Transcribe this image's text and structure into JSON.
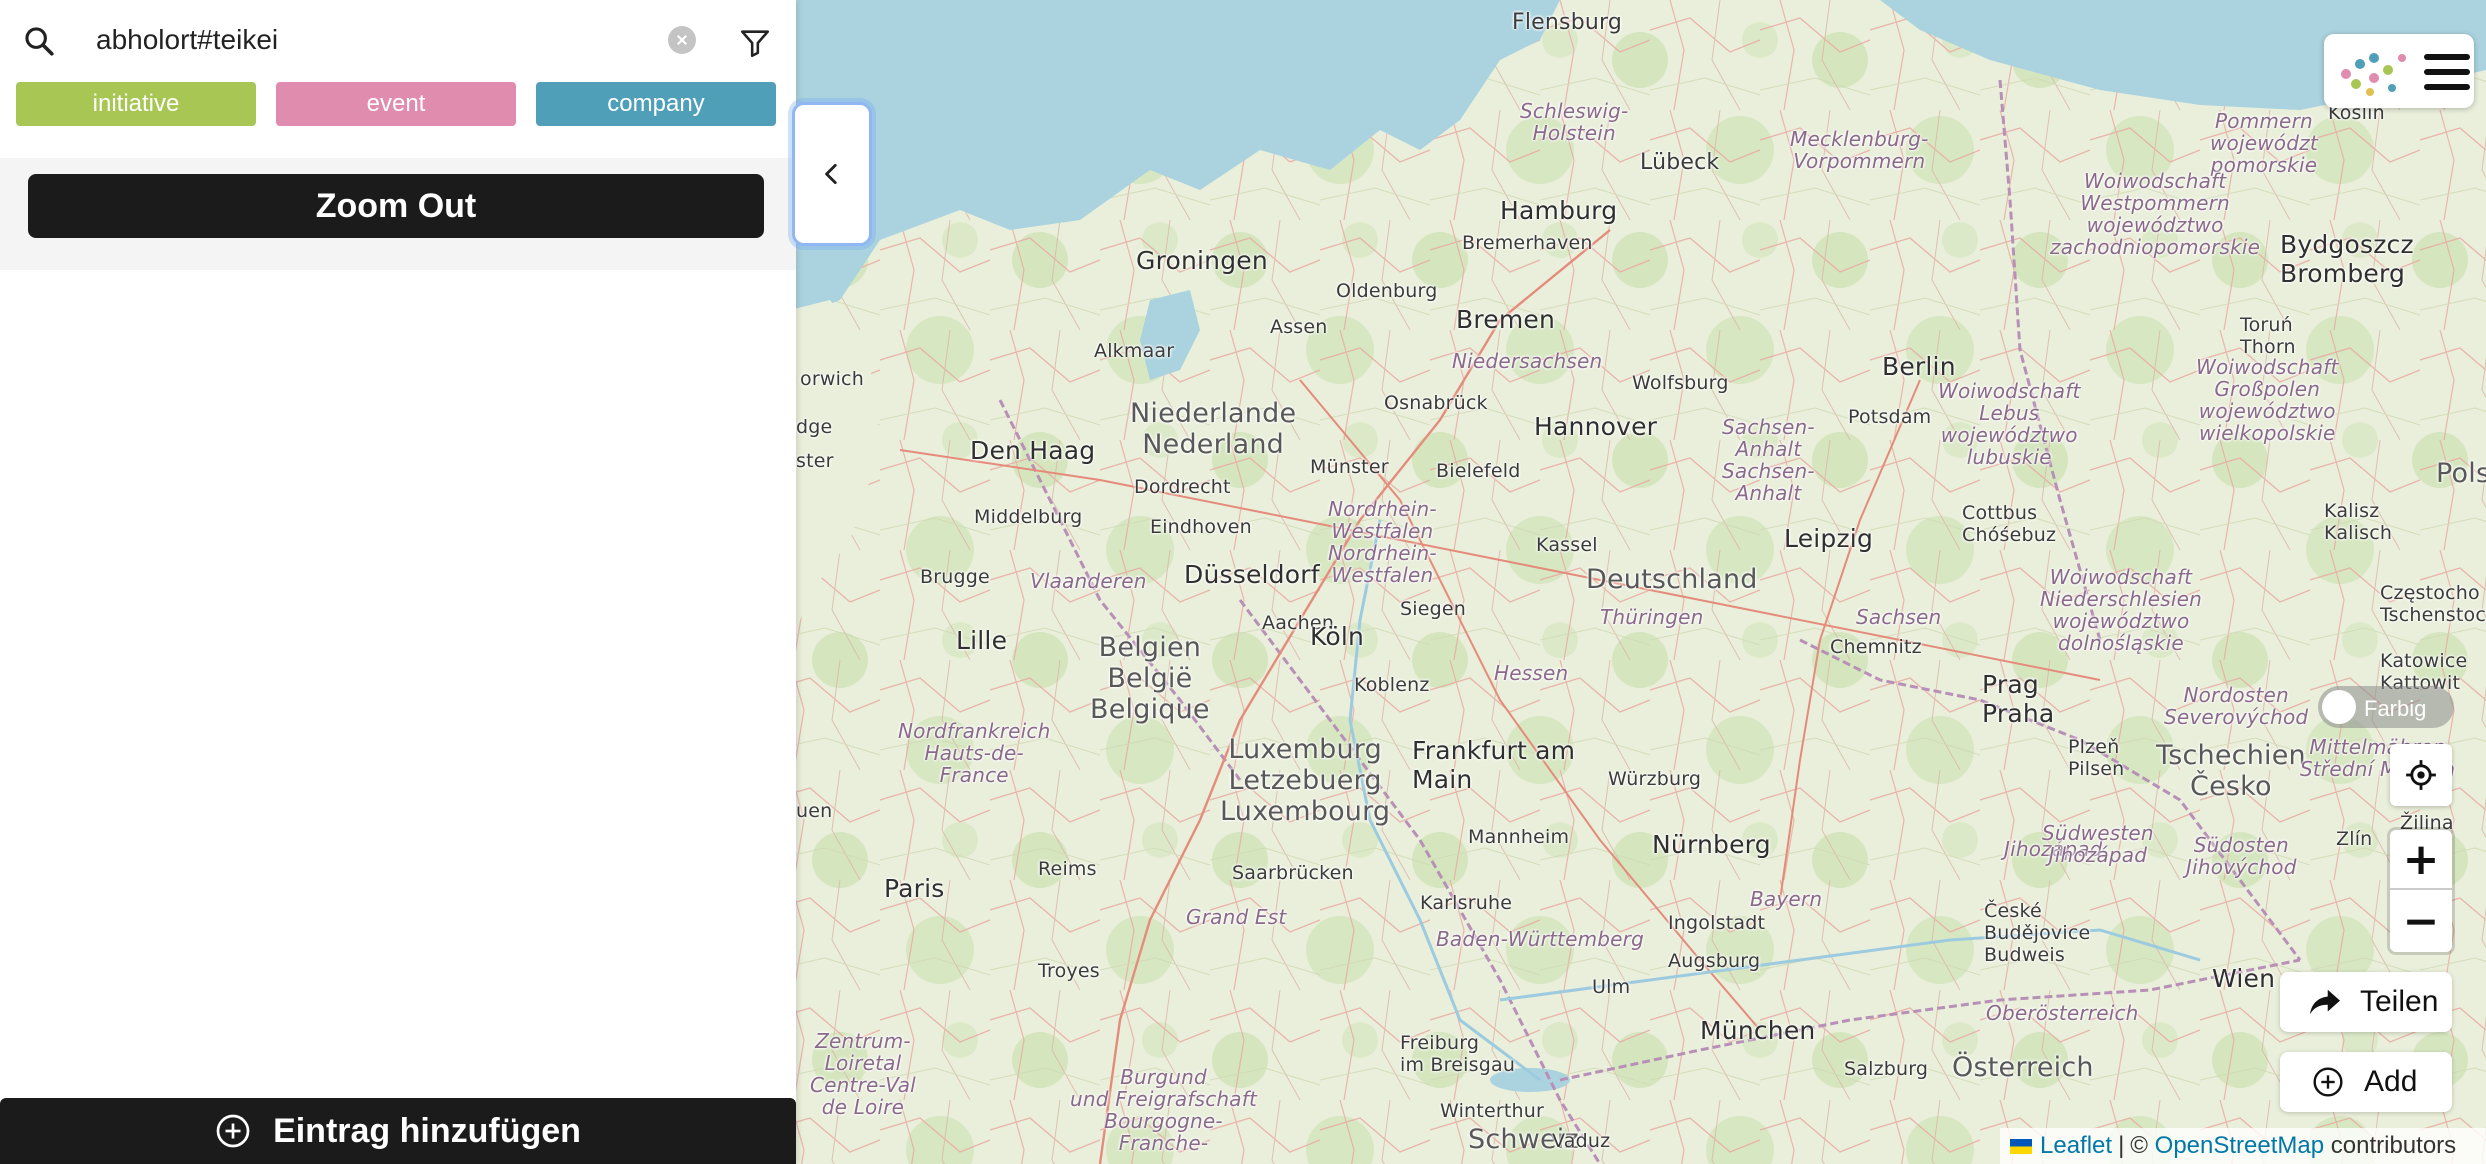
{
  "search": {
    "value": "abholort#teikei"
  },
  "tags": [
    {
      "label": "initiative",
      "color": "#a8c653"
    },
    {
      "label": "event",
      "color": "#e08caf"
    },
    {
      "label": "company",
      "color": "#4f9fb9"
    }
  ],
  "zoom_out_label": "Zoom Out",
  "add_entry_label": "Eintrag hinzufügen",
  "controls": {
    "toggle_label": "Farbig",
    "share_label": "Teilen",
    "add_label": "Add"
  },
  "attribution": {
    "leaflet": "Leaflet",
    "separator": "|",
    "copyright": "©",
    "osm": "OpenStreetMap",
    "contributors": "contributors"
  },
  "map": {
    "labels": [
      {
        "text": "Flensburg",
        "cls": ""
      },
      {
        "text": "Schleswig-\nHolstein",
        "cls": "region"
      },
      {
        "text": "Lübeck",
        "cls": ""
      },
      {
        "text": "Mecklenburg-\nVorpommern",
        "cls": "region"
      },
      {
        "text": "Koszalin\nKöslin",
        "cls": "small"
      },
      {
        "text": "Hamburg",
        "cls": "big"
      },
      {
        "text": "Bremerhaven",
        "cls": "small"
      },
      {
        "text": "Groningen",
        "cls": "big"
      },
      {
        "text": "Oldenburg",
        "cls": "small"
      },
      {
        "text": "Bremen",
        "cls": "big"
      },
      {
        "text": "Alkmaar",
        "cls": "small"
      },
      {
        "text": "Assen",
        "cls": "small"
      },
      {
        "text": "Niedersachsen",
        "cls": "region"
      },
      {
        "text": "Wolfsburg",
        "cls": "small"
      },
      {
        "text": "Berlin",
        "cls": "big"
      },
      {
        "text": "Potsdam",
        "cls": "small"
      },
      {
        "text": "Osnabrück",
        "cls": "small"
      },
      {
        "text": "Hannover",
        "cls": "big"
      },
      {
        "text": "Niederlande\nNederland",
        "cls": "country"
      },
      {
        "text": "Den Haag",
        "cls": "big"
      },
      {
        "text": "Münster",
        "cls": "small"
      },
      {
        "text": "Bielefeld",
        "cls": "small"
      },
      {
        "text": "Sachsen-\nAnhalt\nSachsen-\nAnhalt",
        "cls": "region"
      },
      {
        "text": "Dordrecht",
        "cls": "small"
      },
      {
        "text": "Middelburg",
        "cls": "small"
      },
      {
        "text": "Eindhoven",
        "cls": "small"
      },
      {
        "text": "Nordrhein-\nWestfalen\nNordrhein-\nWestfalen",
        "cls": "region"
      },
      {
        "text": "Kassel",
        "cls": "small"
      },
      {
        "text": "Cottbus\nChóśebuz",
        "cls": "small"
      },
      {
        "text": "Leipzig",
        "cls": "big"
      },
      {
        "text": "Düsseldorf",
        "cls": "big"
      },
      {
        "text": "Brugge",
        "cls": "small"
      },
      {
        "text": "Vlaanderen",
        "cls": "region"
      },
      {
        "text": "Deutschland",
        "cls": "country"
      },
      {
        "text": "Aachen",
        "cls": "small"
      },
      {
        "text": "Siegen",
        "cls": "small"
      },
      {
        "text": "Thüringen",
        "cls": "region"
      },
      {
        "text": "Sachsen",
        "cls": "region"
      },
      {
        "text": "Köln",
        "cls": "big"
      },
      {
        "text": "Lille",
        "cls": "big"
      },
      {
        "text": "Belgien\nBelgië\nBelgique",
        "cls": "country"
      },
      {
        "text": "Chemnitz",
        "cls": "small"
      },
      {
        "text": "Koblenz",
        "cls": "small"
      },
      {
        "text": "Hessen",
        "cls": "region"
      },
      {
        "text": "Prag\nPraha",
        "cls": "big"
      },
      {
        "text": "Nordfrankreich\nHauts-de-\nFrance",
        "cls": "region"
      },
      {
        "text": "Frankfurt am\nMain",
        "cls": "big"
      },
      {
        "text": "Luxemburg\nLetzebuerg\nLuxembourg",
        "cls": "country"
      },
      {
        "text": "Plzeň\nPilsen",
        "cls": "small"
      },
      {
        "text": "Tschechien\nČesko",
        "cls": "country"
      },
      {
        "text": "Würzburg",
        "cls": "small"
      },
      {
        "text": "Mannheim",
        "cls": "small"
      },
      {
        "text": "Nürnberg",
        "cls": "big"
      },
      {
        "text": "Paris",
        "cls": "big"
      },
      {
        "text": "Reims",
        "cls": "small"
      },
      {
        "text": "Saarbrücken",
        "cls": "small"
      },
      {
        "text": "Jihozápad",
        "cls": "region"
      },
      {
        "text": "Grand Est",
        "cls": "region"
      },
      {
        "text": "Karlsruhe",
        "cls": "small"
      },
      {
        "text": "Ingolstadt",
        "cls": "small"
      },
      {
        "text": "Bayern",
        "cls": "region"
      },
      {
        "text": "České\nBudějovice\nBudweis",
        "cls": "small"
      },
      {
        "text": "Baden-Württemberg",
        "cls": "region"
      },
      {
        "text": "Troyes",
        "cls": "small"
      },
      {
        "text": "Augsburg",
        "cls": "small"
      },
      {
        "text": "Ulm",
        "cls": "small"
      },
      {
        "text": "Wien",
        "cls": "big"
      },
      {
        "text": "Oberösterreich",
        "cls": "region"
      },
      {
        "text": "München",
        "cls": "big"
      },
      {
        "text": "Zentrum-\nLoiretal\nCentre-Val\nde Loire",
        "cls": "region"
      },
      {
        "text": "Freiburg\nim Breisgau",
        "cls": "small"
      },
      {
        "text": "Salzburg",
        "cls": "small"
      },
      {
        "text": "Österreich",
        "cls": "country"
      },
      {
        "text": "Burgund\nund Freigrafschaft\nBourgogne-\nFranche-",
        "cls": "region"
      },
      {
        "text": "Winterthur",
        "cls": "small"
      },
      {
        "text": "Schweiz",
        "cls": "country"
      },
      {
        "text": "Vaduz",
        "cls": "small"
      },
      {
        "text": "Bydgoszcz\nBromberg",
        "cls": "big"
      },
      {
        "text": "Toruń\nThorn",
        "cls": "small"
      },
      {
        "text": "Polsk",
        "cls": "country"
      },
      {
        "text": "Kalisz\nKalisch",
        "cls": "small"
      },
      {
        "text": "Częstocho\nTschenstoc",
        "cls": "small"
      },
      {
        "text": "Katowice\nKattowit",
        "cls": "small"
      },
      {
        "text": "Zlín",
        "cls": "small"
      },
      {
        "text": "Žilina",
        "cls": "small"
      },
      {
        "text": "orwich",
        "cls": "small"
      },
      {
        "text": "dge",
        "cls": "small"
      },
      {
        "text": "ster",
        "cls": "small"
      },
      {
        "text": "uen",
        "cls": "small"
      },
      {
        "text": "Pommern\nwojewództ\npomorskie",
        "cls": "region"
      },
      {
        "text": "Woiwodschaft\nWestpommern\nwojewództwo\nzachodniopomorskie",
        "cls": "region"
      },
      {
        "text": "Woiwodschaft\nLebus\nwojewództwo\nlubuskie",
        "cls": "region"
      },
      {
        "text": "Woiwodschaft\nGroßpolen\nwojewództwo\nwielkopolskie",
        "cls": "region"
      },
      {
        "text": "Woiwodschaft\nNiederschlesien\nwojewództwo\ndolnośląskie",
        "cls": "region"
      },
      {
        "text": "Nordosten\nSeverovýchod",
        "cls": "region"
      },
      {
        "text": "Südwesten\nJihozápad",
        "cls": "region"
      },
      {
        "text": "Südosten\nJihovýchod",
        "cls": "region"
      },
      {
        "text": "Mittelmähren\nStřední Morava",
        "cls": "region"
      }
    ]
  }
}
